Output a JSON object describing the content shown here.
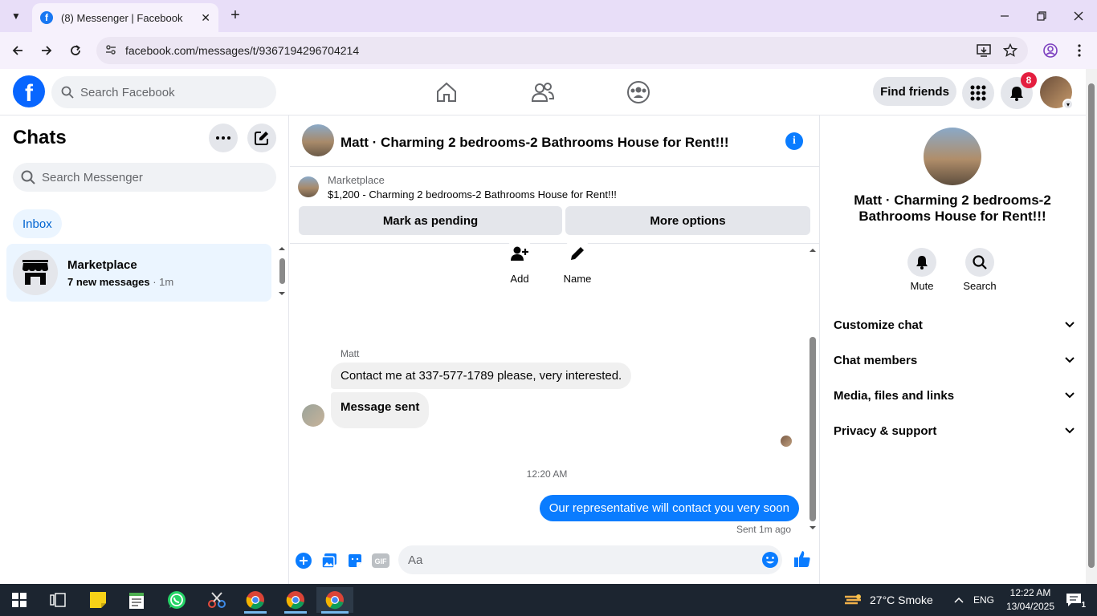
{
  "browser": {
    "tab_title": "(8) Messenger | Facebook",
    "url": "facebook.com/messages/t/9367194296704214",
    "new_tab": "+",
    "tab_close": "✕"
  },
  "fb": {
    "search_placeholder": "Search Facebook",
    "find_friends": "Find friends",
    "notif_count": "8"
  },
  "sidebar": {
    "title": "Chats",
    "search_placeholder": "Search Messenger",
    "filter": "Inbox",
    "chats": [
      {
        "name": "Marketplace",
        "preview": "7 new messages",
        "time": " · 1m"
      }
    ]
  },
  "chat": {
    "title": "Matt · Charming 2 bedrooms-2 Bathrooms House for Rent!!!",
    "listing_label": "Marketplace",
    "listing_desc": "$1,200 - Charming 2 bedrooms-2 Bathrooms House for Rent!!!",
    "mark_pending": "Mark as pending",
    "more_options": "More options",
    "actions": {
      "add": "Add",
      "name": "Name"
    },
    "sender": "Matt",
    "messages": [
      {
        "text": "Contact me at 337-577-1789 please, very interested.",
        "from": "them"
      },
      {
        "text": "Message sent",
        "from": "them"
      },
      {
        "text": "Our representative will contact you very soon",
        "from": "me"
      }
    ],
    "timestamp": "12:20 AM",
    "sent_status": "Sent 1m ago",
    "composer_placeholder": "Aa"
  },
  "details": {
    "title": "Matt · Charming 2 bedrooms-2 Bathrooms House for Rent!!!",
    "mute": "Mute",
    "search": "Search",
    "sections": [
      "Customize chat",
      "Chat members",
      "Media, files and links",
      "Privacy & support"
    ]
  },
  "taskbar": {
    "weather": "27°C  Smoke",
    "lang": "ENG",
    "time": "12:22 AM",
    "date": "13/04/2025",
    "notif": "1"
  },
  "colors": {
    "brand": "#0866ff",
    "bubble_me": "#0a7cff",
    "selected_bg": "#ebf5ff"
  }
}
